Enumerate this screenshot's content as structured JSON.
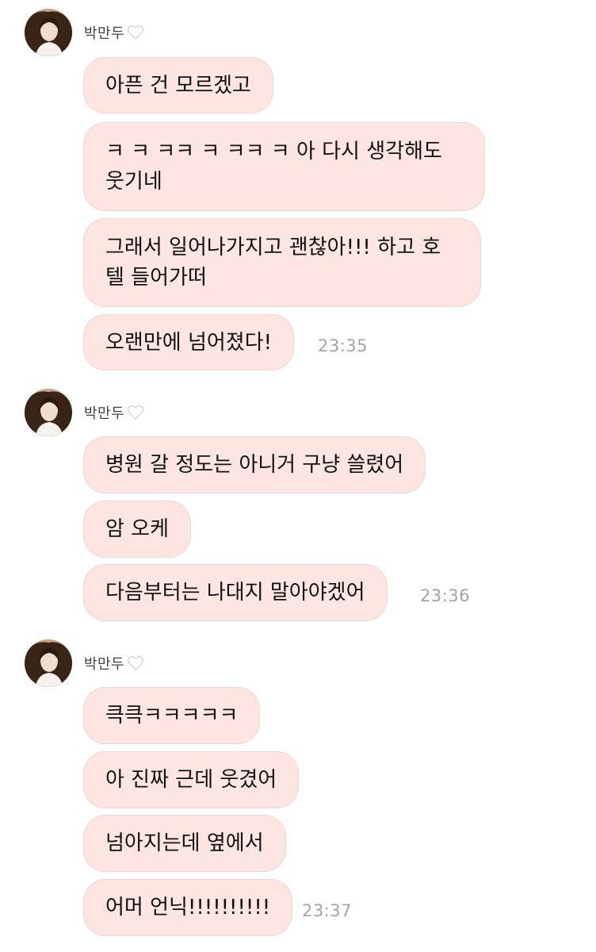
{
  "groups": [
    {
      "sender": "박만두",
      "messages": [
        "아픈 건 모르겠고",
        "ㅋ ㅋ ㅋㅋ ㅋ ㅋㅋ ㅋ 아 다시 생각해도\n웃기네",
        "그래서 일어나가지고 괜찮아!!! 하고 호\n텔 들어가떠",
        "오랜만에 넘어졌다!"
      ],
      "time": "23:35"
    },
    {
      "sender": "박만두",
      "messages": [
        "병원 갈 정도는 아니거 구냥 쓸렸어",
        "암 오케",
        "다음부터는 나대지 말아야겠어"
      ],
      "time": "23:36"
    },
    {
      "sender": "박만두",
      "messages": [
        "큭큭ㅋㅋㅋㅋㅋ",
        "아 진짜 근데 웃겼어",
        "넘아지는데 옆에서",
        "어머 언닉!!!!!!!!!!"
      ],
      "time": "23:37"
    }
  ],
  "colors": {
    "bubble": "#fde5e2",
    "time": "#a4a4a4",
    "sender": "#444444"
  },
  "icons": {
    "heart": "white-heart-icon",
    "avatar": "profile-avatar"
  }
}
